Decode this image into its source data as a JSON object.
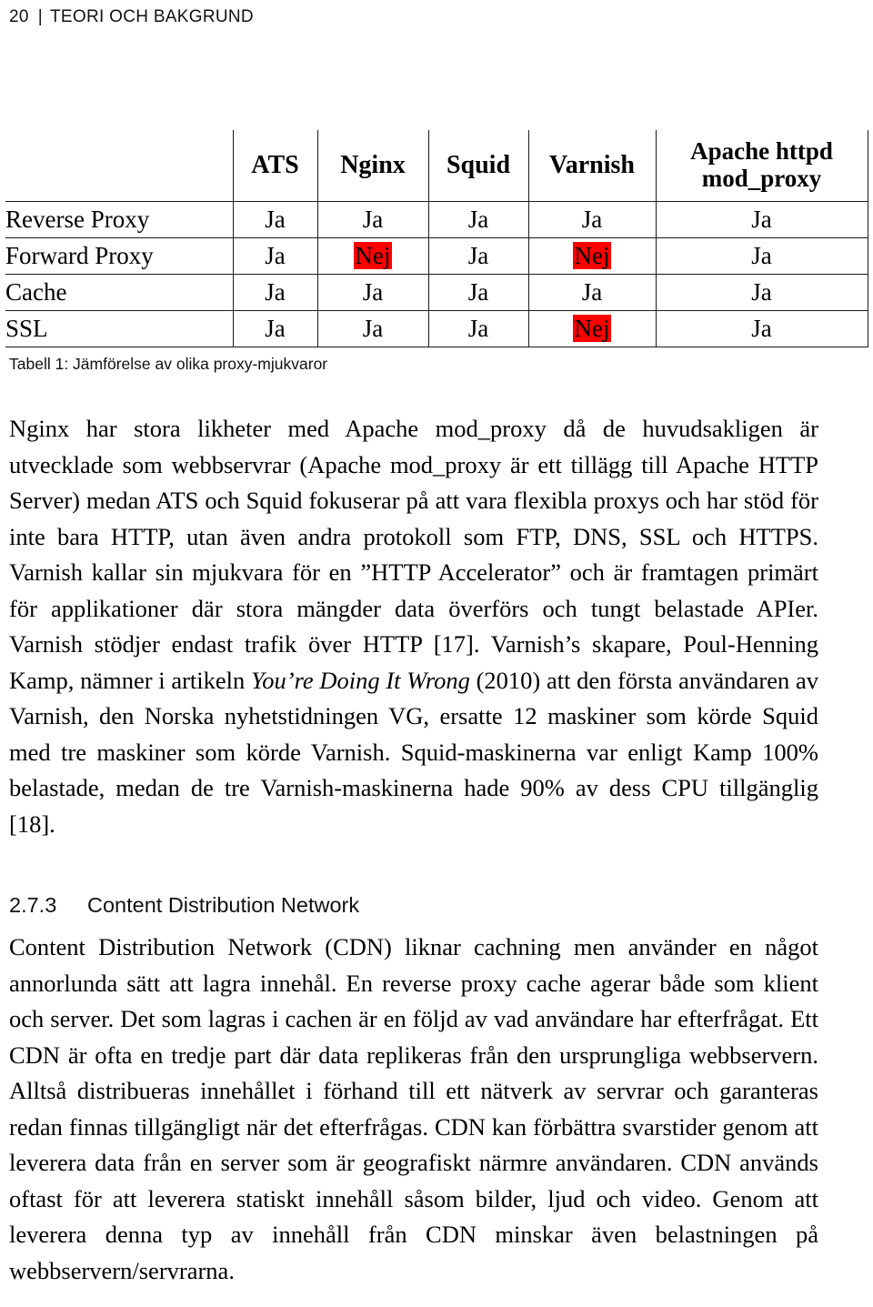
{
  "running_header": {
    "page_number": "20",
    "separator": "|",
    "chapter": "TEORI OCH BAKGRUND"
  },
  "table": {
    "corner_label": "",
    "columns": [
      "ATS",
      "Nginx",
      "Squid",
      "Varnish",
      "Apache httpd mod_proxy"
    ],
    "column_apache_line1": "Apache httpd",
    "column_apache_line2": "mod_proxy",
    "highlight_color": "#ff0000",
    "yes_label": "Ja",
    "no_label": "Nej",
    "rows": [
      {
        "label": "Reverse Proxy",
        "values": [
          "Ja",
          "Ja",
          "Ja",
          "Ja",
          "Ja"
        ]
      },
      {
        "label": "Forward Proxy",
        "values": [
          "Ja",
          "Nej",
          "Ja",
          "Nej",
          "Ja"
        ]
      },
      {
        "label": "Cache",
        "values": [
          "Ja",
          "Ja",
          "Ja",
          "Ja",
          "Ja"
        ]
      },
      {
        "label": "SSL",
        "values": [
          "Ja",
          "Ja",
          "Ja",
          "Nej",
          "Ja"
        ]
      }
    ],
    "caption": "Tabell 1: Jämförelse av olika proxy-mjukvaror"
  },
  "paragraphs": {
    "p1_part1": "Nginx har stora likheter med Apache mod_proxy då de huvudsakligen är utvecklade som webbservrar (Apache mod_proxy är ett tillägg till Apache HTTP Server) medan ATS och Squid fokuserar på att vara flexibla proxys och har stöd för inte bara HTTP, utan även andra protokoll som FTP, DNS, SSL och HTTPS. Varnish kallar sin mjukvara för en ”HTTP Accelerator” och är framtagen primärt för applikationer där stora mängder data överförs och tungt belastade APIer. Varnish stödjer endast trafik över HTTP [17]. Varnish’s skapare, Poul-Henning Kamp, nämner i artikeln ",
    "p1_italic": "You’re Doing It Wrong",
    "p1_part2": " (2010) att den första användaren av Varnish, den Norska nyhetstidningen VG, ersatte 12 maskiner som körde Squid med tre maskiner som körde Varnish. Squid-maskinerna var enligt Kamp 100% belastade, medan de tre Varnish-maskinerna hade 90% av dess CPU tillgänglig [18].",
    "p2": "Content Distribution Network (CDN) liknar cachning men använder en något annorlunda sätt att lagra innehål. En reverse proxy cache agerar både som klient och server. Det som lagras i cachen är en följd av vad användare har efterfrågat. Ett CDN är ofta en tredje part där data replikeras från den ursprungliga webbservern. Alltså distribueras innehållet i förhand till ett nätverk av servrar och garanteras redan finnas tillgängligt när det efterfrågas. CDN kan förbättra svarstider genom att leverera data från en server som är geografiskt närmre användaren. CDN används oftast för att leverera statiskt innehåll såsom bilder, ljud och video. Genom att leverera denna typ av innehåll från CDN minskar även belastningen på webbservern/servrarna."
  },
  "section": {
    "number": "2.7.3",
    "title": "Content Distribution Network"
  }
}
